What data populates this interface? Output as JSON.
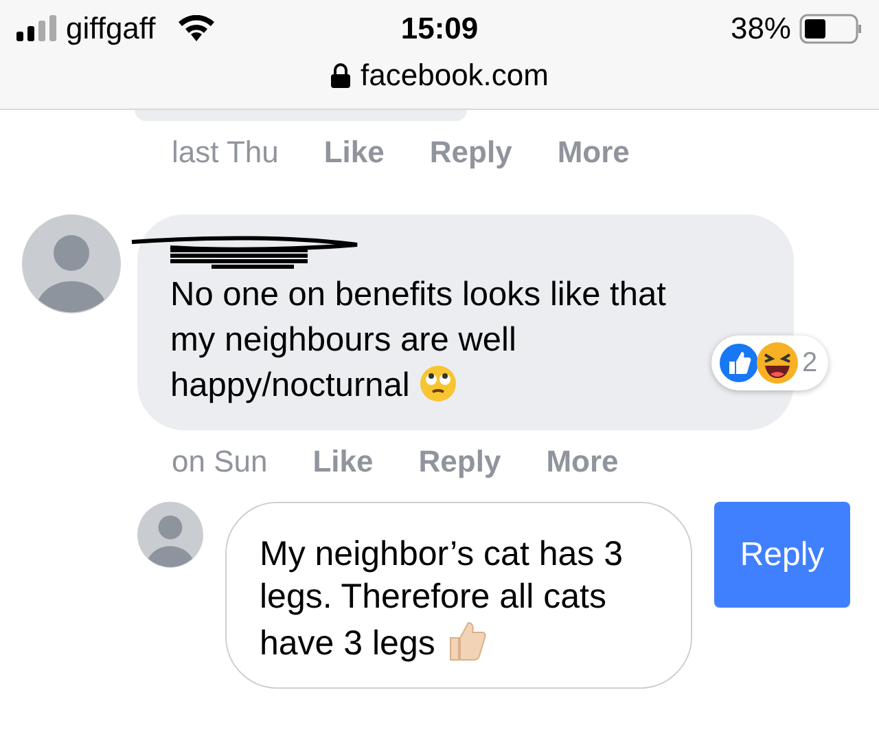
{
  "status_bar": {
    "carrier": "giffgaff",
    "time": "15:09",
    "battery": "38%"
  },
  "address_bar": {
    "url": "facebook.com",
    "secure": true
  },
  "thread": [
    {
      "kind": "cutoff",
      "time": "last Thu",
      "actions": [
        "Like",
        "Reply",
        "More"
      ]
    },
    {
      "kind": "comment",
      "name_redacted": true,
      "text": "No one on benefits looks like that my neighbours are well happy/nocturnal",
      "reaction_count": "2",
      "time": "on Sun",
      "actions": [
        "Like",
        "Reply",
        "More"
      ]
    }
  ],
  "composer": {
    "value": "My neighbor’s cat has 3 legs. Therefore all cats have 3 legs",
    "button": "Reply"
  }
}
